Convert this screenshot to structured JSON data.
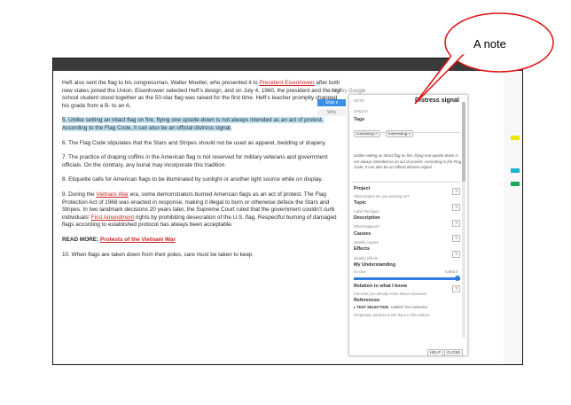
{
  "article": {
    "p1": {
      "a": "Heft also sent the flag to his congressman, Walter Moeller, who presented it to ",
      "link": "President Eisenhower",
      "b": " after both new states joined the Union. Eisenhower selected Heft’s design, and on July 4, 1960, the president and the high school student stood together as the 50-star flag was raised for the first time. Heft’s teacher promptly changed his grade from a B- to an A."
    },
    "p5": "5. Unlike setting an intact flag on fire, flying one upside-down is not always intended as an act of protest. According to the Flag Code, it can also be an official distress signal.",
    "p6": "6. The Flag Code stipulates that the Stars and Stripes should not be used as apparel, bedding or drapery.",
    "p7": "7. The practice of draping coffins in the American flag is not reserved for military veterans and government officials. On the contrary, any burial may incorporate this tradition.",
    "p8": "8. Etiquette calls for American flags to be illuminated by sunlight or another light source while on display.",
    "p9": {
      "a": "9. During the ",
      "link1": "Vietnam War",
      "b": " era, some demonstrators burned American flags as an act of protest. The Flag Protection Act of 1968 was enacted in response, making it illegal to burn or otherwise deface the Stars and Stripes. In two landmark decisions 20 years later, the Supreme Court ruled that the government couldn’t curb individuals’ ",
      "link2": "First Amendment",
      "c": " rights by prohibiting desecration of the U.S. flag. Respectful burning of damaged flags according to established protocol has always been acceptable."
    },
    "readmore_label": "READ MORE: ",
    "readmore_link": "Protests of the Vietnam War",
    "p10": "10. When flags are taken down from their poles, care must be taken to keep"
  },
  "ad": {
    "by_label": "Ads by Google",
    "btn1": "Stop s",
    "btn2": "Why"
  },
  "panel": {
    "note_label": "NOTE",
    "title": "Distress signal",
    "author": "SHILOH",
    "tags_label": "Tags",
    "tags": [
      "confusing",
      "interesting"
    ],
    "quote": "Unlike setting an intact flag on fire, flying one upside-down is not always intended as an act of protest. According to the Flag Code, it can also be an official distress signal",
    "project_label": "Project",
    "project_hint": "What project are you working on?",
    "topic_label": "Topic",
    "topic_hint": "Label the figure",
    "description_label": "Description",
    "description_hint": "What happens?",
    "causes_label": "Causes",
    "causes_hint": "Identify causes",
    "effects_label": "Effects",
    "effects_hint": "Identify effects",
    "understanding_label": "My Understanding",
    "understanding_low": "no clue",
    "understanding_high": "nailed it",
    "understanding_value": 1.0,
    "relation_label": "Relation to what I know",
    "relation_hint": "List what you already know about volcanoes",
    "references_label": "References",
    "reference_item": "TEXT SELECTION",
    "reference_detail": "- Untitled Text Selection",
    "drop_hint": "Drop/paste artifacts to link them to this artifact.",
    "help_btn": "HELP",
    "close_btn": "CLOSE",
    "question_mark": "?"
  },
  "callout": {
    "text": "A note"
  },
  "colors": {
    "highlight": "#bfe0f3",
    "link": "#cc2222",
    "accent_blue": "#2f7de1",
    "marker_yellow": "#f2e600",
    "marker_cyan": "#19b6d2",
    "marker_green": "#19a85b",
    "callout_red": "#e01010"
  }
}
